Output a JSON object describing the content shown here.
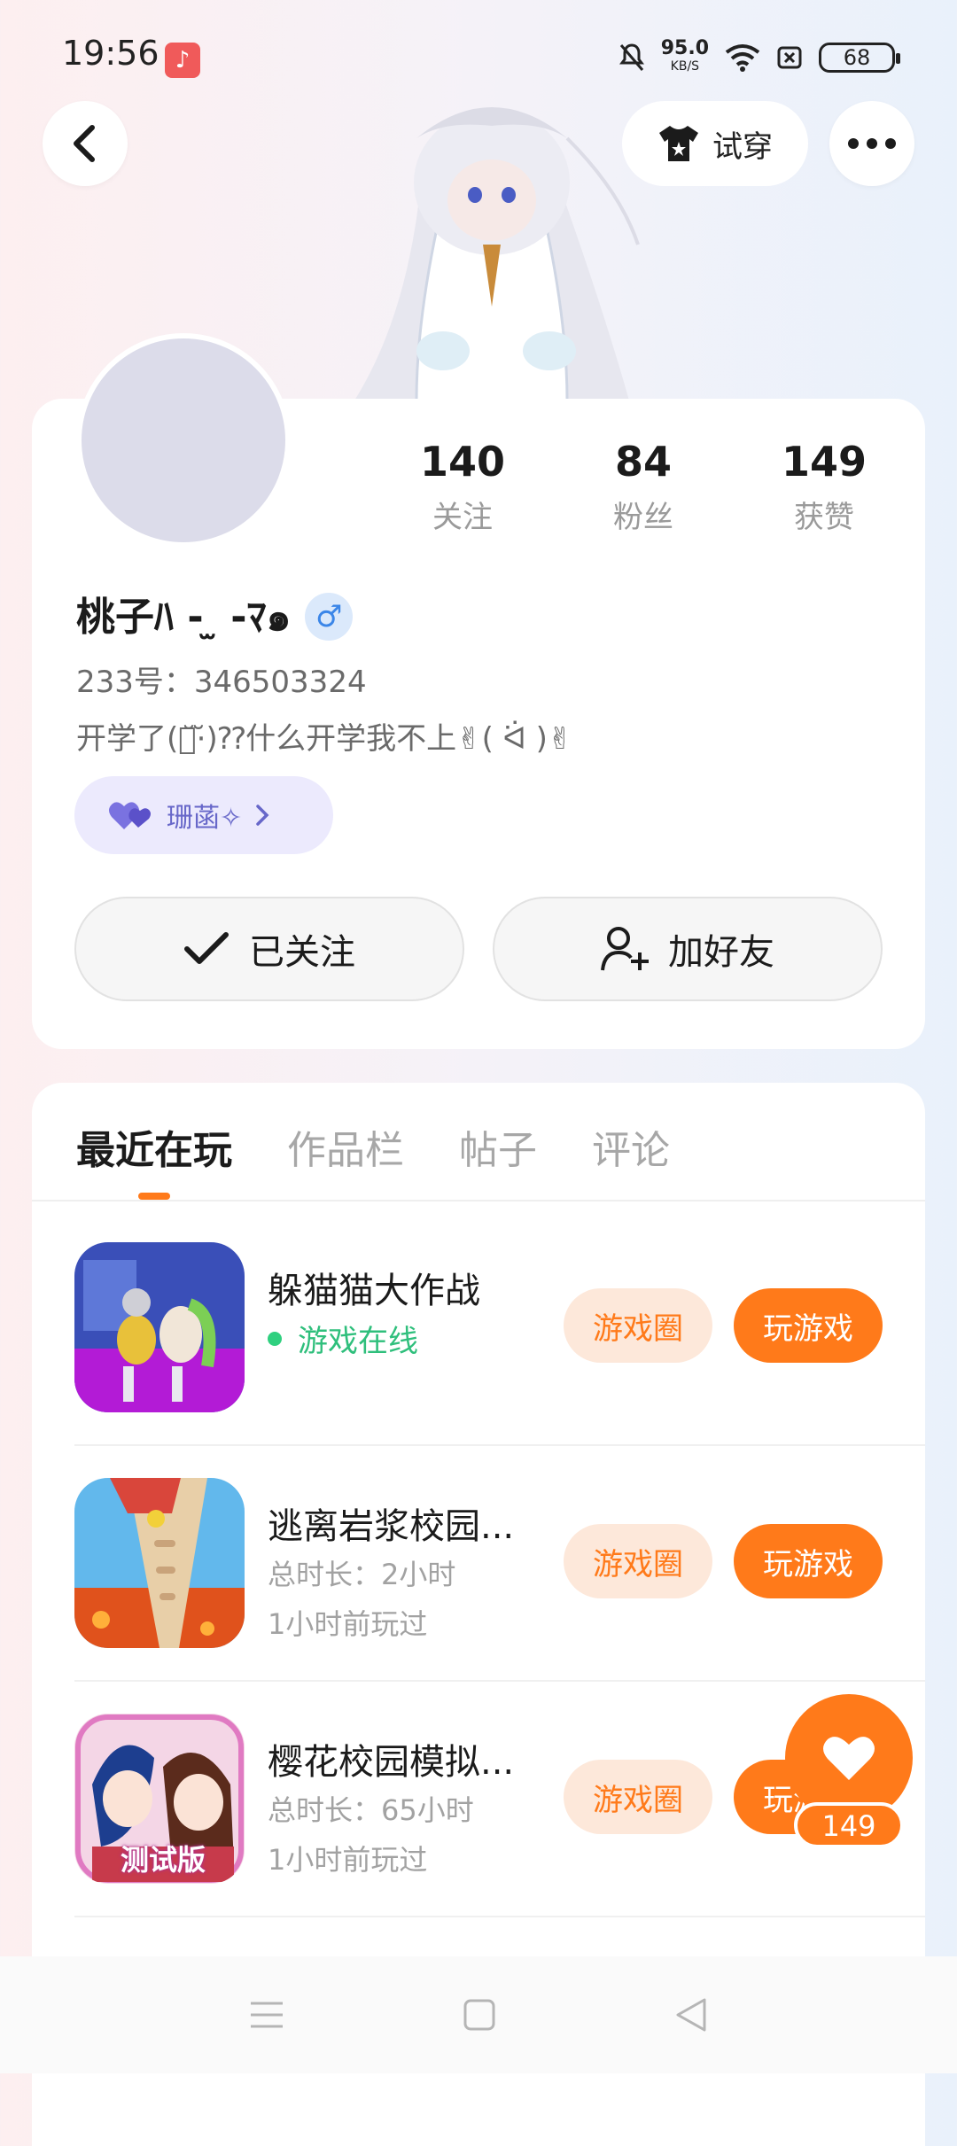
{
  "status_bar": {
    "time": "19:56",
    "app_badge_glyph": "♪",
    "net_speed": "95.0",
    "net_unit": "KB/S",
    "battery": "68"
  },
  "header": {
    "try_on_label": "试穿"
  },
  "profile": {
    "stats": [
      {
        "value": "140",
        "label": "关注"
      },
      {
        "value": "84",
        "label": "粉丝"
      },
      {
        "value": "149",
        "label": "获赞"
      }
    ],
    "nickname": "桃子ﾊ - ̫ -ﾏ๑",
    "gender_symbol": "♂",
    "uid_line": "233号：346503324",
    "bio": "开学了(･̆·̆)⁇什么开学我不上✌︎( ᐛ )✌︎",
    "tag_label": "珊菡✧",
    "follow_button": "已关注",
    "add_friend_button": "加好友"
  },
  "tabs": [
    "最近在玩",
    "作品栏",
    "帖子",
    "评论"
  ],
  "games": [
    {
      "title": "躲猫猫大作战",
      "status": "游戏在线",
      "circle_label": "游戏圈",
      "play_label": "玩游戏"
    },
    {
      "title": "逃离岩浆校园...",
      "duration": "总时长：2小时",
      "last_played": "1小时前玩过",
      "circle_label": "游戏圈",
      "play_label": "玩游戏"
    },
    {
      "title": "樱花校园模拟...",
      "duration": "总时长：65小时",
      "last_played": "1小时前玩过",
      "circle_label": "游戏圈",
      "play_label": "玩游戏",
      "thumb_badge": "测试版"
    }
  ],
  "like_fab": {
    "count": "149"
  },
  "colors": {
    "accent": "#ff7a1a",
    "online": "#2fbf7c",
    "tag": "#6767c9"
  }
}
